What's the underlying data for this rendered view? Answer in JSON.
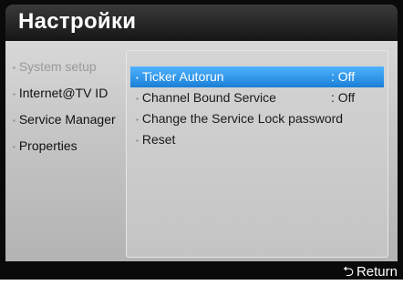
{
  "header": {
    "title": "Настройки"
  },
  "sidebar": {
    "items": [
      {
        "label": "System setup"
      },
      {
        "label": "Internet@TV ID"
      },
      {
        "label": "Service Manager"
      },
      {
        "label": "Properties"
      }
    ]
  },
  "menu": {
    "items": [
      {
        "label": "Ticker Autorun",
        "value": ": Off"
      },
      {
        "label": "Channel Bound Service",
        "value": ": Off"
      },
      {
        "label": "Change the Service Lock password",
        "value": ""
      },
      {
        "label": "Reset",
        "value": ""
      }
    ]
  },
  "footer": {
    "return_label": "Return"
  },
  "colors": {
    "highlight": "#2a94ec",
    "title_bar": "#1e1e1e",
    "panel": "#c8c8c8"
  },
  "icons": {
    "return": "return-arrow-icon"
  }
}
